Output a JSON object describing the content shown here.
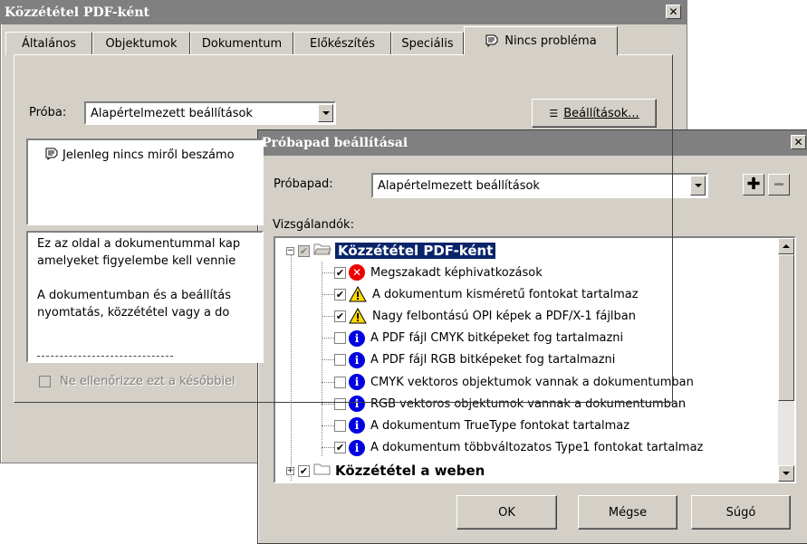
{
  "back_dialog": {
    "title": "Közzététel PDF-ként",
    "tabs": [
      {
        "label": "Általános"
      },
      {
        "label": "Objektumok"
      },
      {
        "label": "Dokumentum"
      },
      {
        "label": "Előkészítés"
      },
      {
        "label": "Speciális"
      },
      {
        "label": "Nincs probléma",
        "icon": "report-icon"
      }
    ],
    "test_label": "Próba:",
    "test_value": "Alapértelmezett beállítások",
    "settings_button": "Beállítások...",
    "status_text": "Jelenleg nincs miről beszámo",
    "desc_line1": "Ez az oldal a dokumentummal kap",
    "desc_line2": "amelyeket figyelembe kell vennie",
    "desc_line3": "A dokumentumban és a beállítás",
    "desc_line4": "nyomtatás, közzététel vagy a do",
    "dont_check_label": "Ne ellenőrizze ezt a későbbiel"
  },
  "front_dialog": {
    "title": "Próbapad beállításai",
    "profile_label": "Próbapad:",
    "profile_value": "Alapértelmezett beállítások",
    "items_label": "Vizsgálandók:",
    "groups": [
      {
        "label": "Közzététel PDF-ként",
        "expanded": true,
        "selected": true
      },
      {
        "label": "Közzététel a weben",
        "expanded": false
      }
    ],
    "checks": [
      {
        "label": "Megszakadt képhivatkozások",
        "checked": true,
        "type": "error"
      },
      {
        "label": "A dokumentum kisméretű fontokat tartalmaz",
        "checked": true,
        "type": "warning"
      },
      {
        "label": "Nagy felbontású OPI képek a PDF/X-1 fájlban",
        "checked": true,
        "type": "warning"
      },
      {
        "label": "A PDF fájl CMYK bitképeket fog tartalmazni",
        "checked": false,
        "type": "info"
      },
      {
        "label": "A PDF fájl RGB bitképeket fog tartalmazni",
        "checked": false,
        "type": "info"
      },
      {
        "label": "CMYK vektoros objektumok vannak a dokumentumban",
        "checked": false,
        "type": "info"
      },
      {
        "label": "RGB vektoros objektumok vannak a dokumentumban",
        "checked": false,
        "type": "info"
      },
      {
        "label": "A dokumentum TrueType fontokat tartalmaz",
        "checked": false,
        "type": "info"
      },
      {
        "label": "A dokumentum többváltozatos Type1 fontokat tartalmaz",
        "checked": true,
        "type": "info"
      }
    ],
    "ok_button": "OK",
    "cancel_button": "Mégse",
    "help_button": "Súgó"
  }
}
